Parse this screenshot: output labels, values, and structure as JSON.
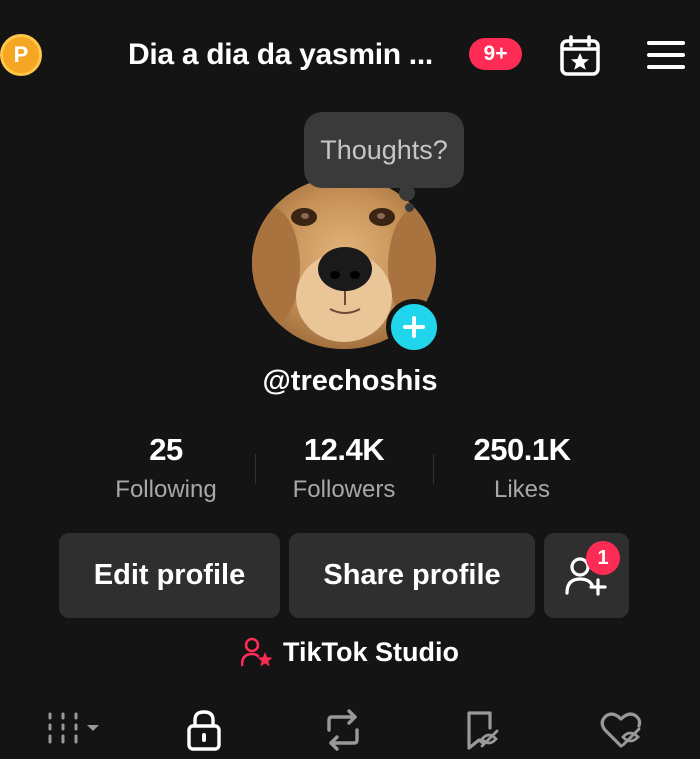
{
  "header": {
    "coin_letter": "P",
    "title": "Dia a dia da yasmin ...",
    "notification_badge": "9+"
  },
  "profile": {
    "bubble_text": "Thoughts?",
    "username": "@trechoshis"
  },
  "stats": [
    {
      "value": "25",
      "label": "Following"
    },
    {
      "value": "12.4K",
      "label": "Followers"
    },
    {
      "value": "250.1K",
      "label": "Likes"
    }
  ],
  "actions": {
    "edit_label": "Edit profile",
    "share_label": "Share profile",
    "add_friends_badge": "1"
  },
  "studio": {
    "label": "TikTok Studio"
  },
  "tabs": [
    {
      "icon": "grid-icon"
    },
    {
      "icon": "lock-icon"
    },
    {
      "icon": "repost-icon"
    },
    {
      "icon": "bookmark-hidden-icon"
    },
    {
      "icon": "liked-hidden-icon"
    }
  ],
  "colors": {
    "background": "#141414",
    "accent_red": "#fe2c55",
    "accent_cyan": "#20d5ec",
    "coin": "#f5a623",
    "button_bg": "#2f2f2f"
  }
}
